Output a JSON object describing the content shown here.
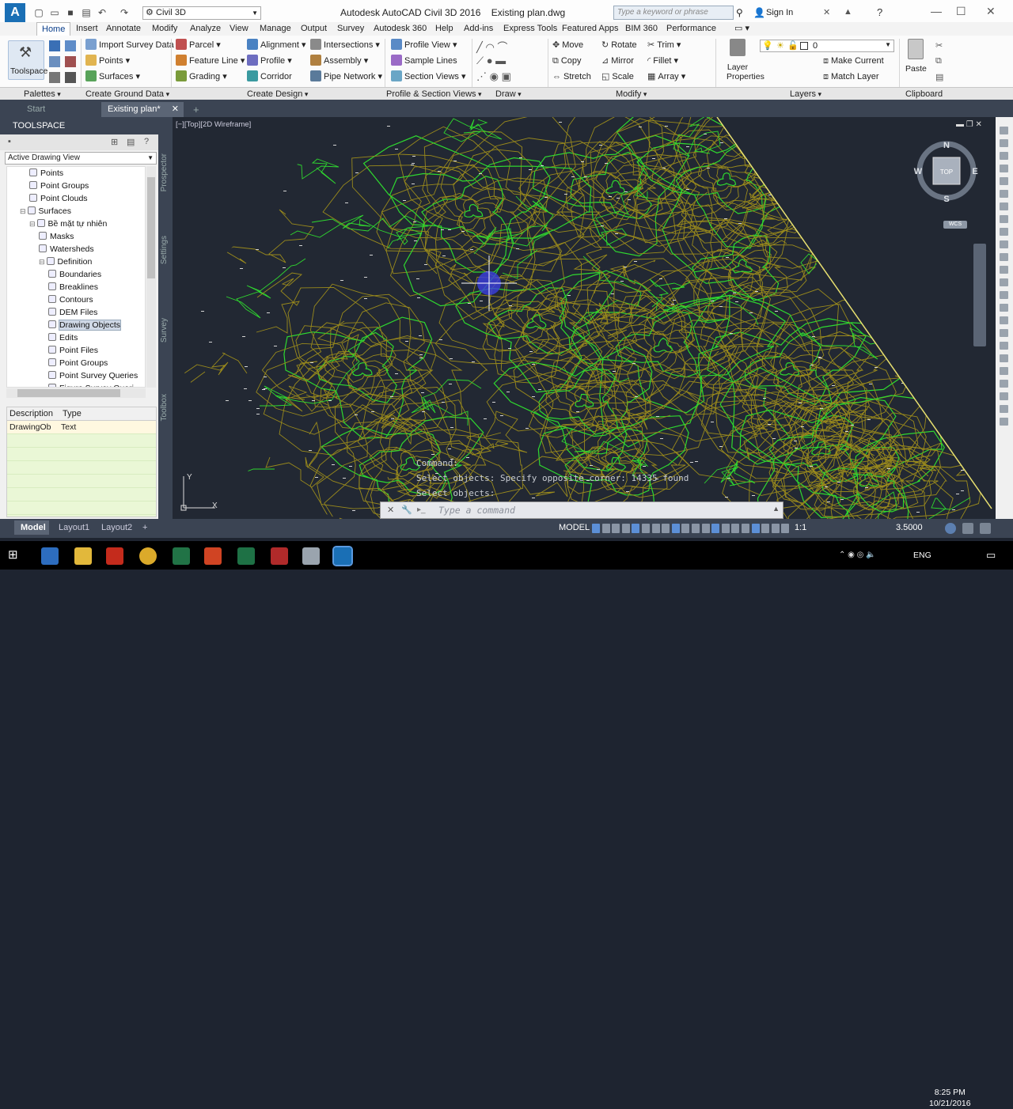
{
  "titlebar": {
    "workspace": "Civil 3D",
    "app_title": "Autodesk AutoCAD Civil 3D 2016",
    "file_name": "Existing plan.dwg",
    "search_placeholder": "Type a keyword or phrase",
    "signin_label": "Sign In"
  },
  "ribbon_tabs": [
    "Home",
    "Insert",
    "Annotate",
    "Modify",
    "Analyze",
    "View",
    "Manage",
    "Output",
    "Survey",
    "Autodesk 360",
    "Help",
    "Add-ins",
    "Express Tools",
    "Featured Apps",
    "BIM 360",
    "Performance"
  ],
  "ribbon": {
    "toolspace": "Toolspace",
    "import_survey": "Import Survey Data",
    "points": "Points",
    "surfaces": "Surfaces",
    "parcel": "Parcel",
    "feature_line": "Feature Line",
    "grading": "Grading",
    "alignment": "Alignment",
    "profile": "Profile",
    "corridor": "Corridor",
    "intersections": "Intersections",
    "assembly": "Assembly",
    "pipe_network": "Pipe Network",
    "profile_view": "Profile View",
    "sample_lines": "Sample Lines",
    "section_views": "Section Views",
    "move": "Move",
    "copy": "Copy",
    "stretch": "Stretch",
    "rotate": "Rotate",
    "mirror": "Mirror",
    "scale": "Scale",
    "trim": "Trim",
    "fillet": "Fillet",
    "array": "Array",
    "layer_properties": "Layer Properties",
    "layer_value": "0",
    "make_current": "Make Current",
    "match_layer": "Match Layer",
    "paste": "Paste"
  },
  "panels": [
    "Palettes",
    "Create Ground Data",
    "Create Design",
    "Profile & Section Views",
    "Draw",
    "Modify",
    "Layers",
    "Clipboard"
  ],
  "doc_tabs": {
    "start": "Start",
    "active": "Existing plan*",
    "add": "+"
  },
  "toolspace": {
    "title": "TOOLSPACE",
    "view": "Active Drawing View",
    "tree": [
      {
        "label": "Points",
        "indent": 2
      },
      {
        "label": "Point Groups",
        "indent": 2
      },
      {
        "label": "Point Clouds",
        "indent": 2
      },
      {
        "label": "Surfaces",
        "indent": 1
      },
      {
        "label": "Bề mặt tự nhiên",
        "indent": 2
      },
      {
        "label": "Masks",
        "indent": 3
      },
      {
        "label": "Watersheds",
        "indent": 3
      },
      {
        "label": "Definition",
        "indent": 3
      },
      {
        "label": "Boundaries",
        "indent": 4
      },
      {
        "label": "Breaklines",
        "indent": 4
      },
      {
        "label": "Contours",
        "indent": 4
      },
      {
        "label": "DEM Files",
        "indent": 4
      },
      {
        "label": "Drawing Objects",
        "indent": 4,
        "selected": true
      },
      {
        "label": "Edits",
        "indent": 4
      },
      {
        "label": "Point Files",
        "indent": 4
      },
      {
        "label": "Point Groups",
        "indent": 4
      },
      {
        "label": "Point Survey Queries",
        "indent": 4
      },
      {
        "label": "Figure Survey Queri",
        "indent": 4
      }
    ],
    "columns": [
      "Description",
      "Type"
    ],
    "rows": [
      [
        "DrawingOb",
        "Text"
      ]
    ],
    "side_tabs": [
      "Prospector",
      "Settings",
      "Survey",
      "Toolbox"
    ]
  },
  "viewport": {
    "label": "[−][Top][2D Wireframe]",
    "compass": {
      "n": "N",
      "s": "S",
      "e": "E",
      "w": "W",
      "top": "TOP"
    },
    "wcs": "WCS",
    "command_history": [
      "Command:",
      "Select objects: Specify opposite corner: 14335 found",
      "Select objects:"
    ],
    "command_placeholder": "Type a command"
  },
  "statusbar": {
    "layout_tabs": [
      "Model",
      "Layout1",
      "Layout2"
    ],
    "mode": "MODEL",
    "scale": "1:1",
    "value": "3.5000"
  },
  "taskbar": {
    "time": "8:25 PM",
    "date": "10/21/2016",
    "lang": "ENG"
  },
  "colors": {
    "contour_major": "#9a8a1c",
    "contour_green": "#2fd82f",
    "background": "#222833"
  }
}
